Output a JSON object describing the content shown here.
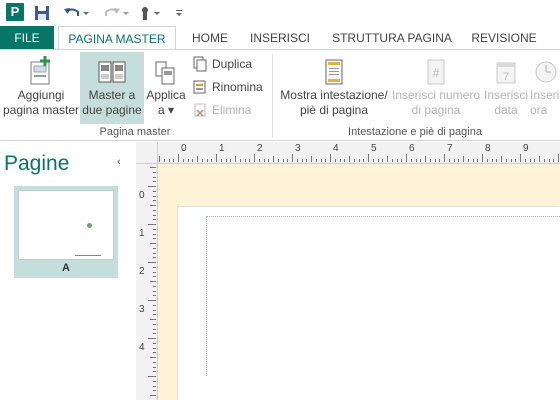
{
  "qat": {
    "app_letter": "P"
  },
  "tabs": [
    {
      "label": "FILE"
    },
    {
      "label": "PAGINA MASTER"
    },
    {
      "label": "HOME"
    },
    {
      "label": "INSERISCI"
    },
    {
      "label": "STRUTTURA PAGINA"
    },
    {
      "label": "REVISIONE"
    }
  ],
  "ribbon": {
    "add_master": {
      "line1": "Aggiungi",
      "line2": "pagina master"
    },
    "two_page_master": {
      "line1": "Master a",
      "line2": "due pagine"
    },
    "apply_to": {
      "line1": "Applica",
      "line2": "a ▾"
    },
    "duplicate": "Duplica",
    "rename": "Rinomina",
    "delete": "Elimina",
    "group_master": "Pagina master",
    "show_header_footer": {
      "line1": "Mostra intestazione/",
      "line2": "piè di pagina"
    },
    "insert_page_number": {
      "line1": "Inserisci numero",
      "line2": "di pagina"
    },
    "insert_date": {
      "line1": "Inserisci",
      "line2": "data"
    },
    "insert_time": {
      "line1": "Inseri",
      "line2": "ora"
    },
    "group_header_footer": "Intestazione e piè di pagina"
  },
  "pane": {
    "title": "Pagine",
    "collapse": "‹",
    "thumb_label": "A"
  },
  "ruler": {
    "h_labels": [
      "0",
      "1",
      "2",
      "3",
      "4",
      "5",
      "6",
      "7",
      "8",
      "9"
    ],
    "v_labels": [
      "1",
      "0",
      "1",
      "2",
      "3",
      "4"
    ]
  },
  "colors": {
    "accent": "#077568",
    "selected": "#c5dedb",
    "workspace": "#fff4d8"
  }
}
